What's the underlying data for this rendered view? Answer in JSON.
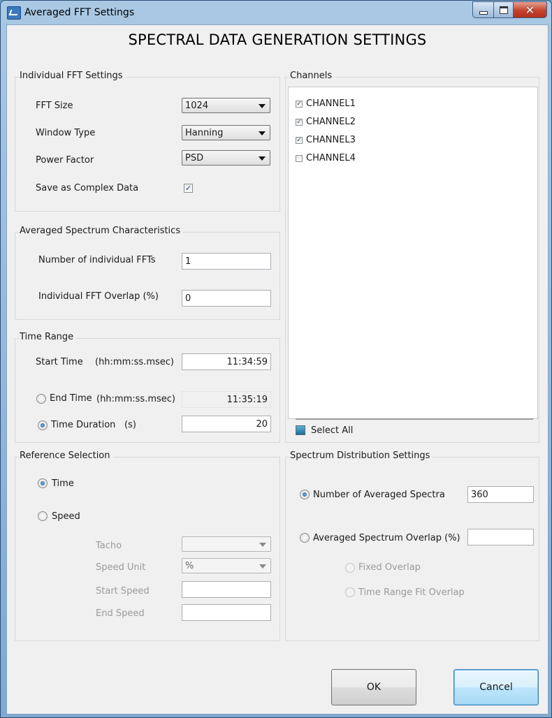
{
  "window": {
    "title": "Averaged FFT Settings",
    "heading": "SPECTRAL DATA GENERATION SETTINGS"
  },
  "individual_fft": {
    "title": "Individual FFT Settings",
    "fft_size_label": "FFT Size",
    "fft_size_value": "1024",
    "window_type_label": "Window Type",
    "window_type_value": "Hanning",
    "power_factor_label": "Power Factor",
    "power_factor_value": "PSD",
    "save_complex_label": "Save as Complex Data",
    "save_complex_checked": true
  },
  "averaged_spectrum": {
    "title": "Averaged Spectrum Characteristics",
    "num_ffts_label": "Number of individual FFTs",
    "num_ffts_value": "1",
    "overlap_label": "Individual FFT Overlap (%)",
    "overlap_value": "0"
  },
  "time_range": {
    "title": "Time Range",
    "start_label": "Start Time",
    "start_unit": "(hh:mm:ss.msec)",
    "start_value": "11:34:59",
    "end_label": "End Time",
    "end_unit": "(hh:mm:ss.msec)",
    "end_value": "11:35:19",
    "duration_label": "Time Duration",
    "duration_unit": "(s)",
    "duration_value": "20",
    "selected": "duration"
  },
  "reference": {
    "title": "Reference Selection",
    "time_label": "Time",
    "speed_label": "Speed",
    "selected": "time",
    "tacho_label": "Tacho",
    "tacho_value": "",
    "speed_unit_label": "Speed Unit",
    "speed_unit_value": "%",
    "start_speed_label": "Start Speed",
    "start_speed_value": "",
    "end_speed_label": "End Speed",
    "end_speed_value": ""
  },
  "channels": {
    "title": "Channels",
    "items": [
      {
        "label": "CHANNEL1",
        "checked": true
      },
      {
        "label": "CHANNEL2",
        "checked": true
      },
      {
        "label": "CHANNEL3",
        "checked": true
      },
      {
        "label": "CHANNEL4",
        "checked": false
      }
    ],
    "select_all_label": "Select All"
  },
  "distribution": {
    "title": "Spectrum Distribution Settings",
    "num_spectra_label": "Number of Averaged Spectra",
    "num_spectra_value": "360",
    "overlap_label": "Averaged Spectrum Overlap (%)",
    "overlap_value": "",
    "fixed_overlap_label": "Fixed Overlap",
    "fit_overlap_label": "Time Range Fit Overlap",
    "selected": "num_spectra"
  },
  "buttons": {
    "ok_label": "OK",
    "cancel_label": "Cancel"
  },
  "colors": {
    "title_bar": "#8fb6dc",
    "close_button": "#c4432e",
    "dialog_background": "#f0f0f0",
    "default_button": "#bee6fd"
  }
}
